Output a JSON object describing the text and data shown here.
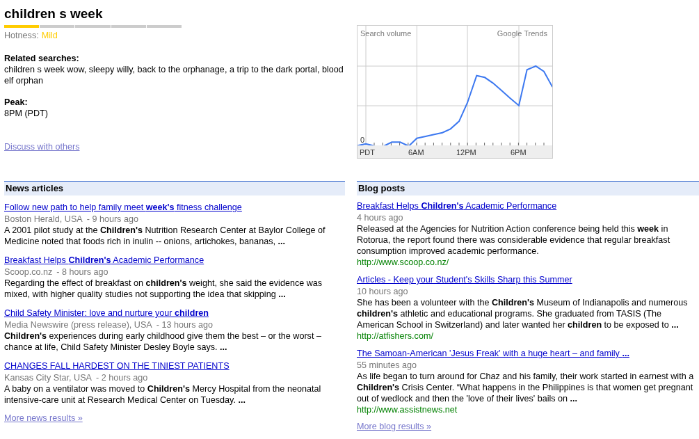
{
  "topic": {
    "title": "children s week",
    "hotness": {
      "label": "Hotness:",
      "value": "Mild",
      "level": 0.2
    },
    "related": {
      "heading": "Related searches:",
      "text": "children s week wow, sleepy willy, back to the orphanage, a trip to the dark portal, blood elf orphan"
    },
    "peak": {
      "heading": "Peak:",
      "value": "8PM (PDT)"
    },
    "discuss_link": "Discuss with others"
  },
  "trend_chart": {
    "title": "Search volume",
    "source": "Google Trends",
    "y_label": "0",
    "x_labels": [
      "PDT",
      "6AM",
      "12PM",
      "6PM"
    ]
  },
  "news": {
    "heading": "News articles",
    "items": [
      {
        "title": "Follow new path to help family meet **week's** fitness challenge",
        "source": "Boston Herald, USA",
        "age": "- 9 hours ago",
        "snippet": "A 2001 pilot study at the **Children's** Nutrition Research Center at Baylor College of Medicine noted that foods rich in inulin -- onions, artichokes, bananas, **...**"
      },
      {
        "title": "Breakfast Helps **Children's** Academic Performance",
        "source": "Scoop.co.nz",
        "age": "- 8 hours ago",
        "snippet": "Regarding the effect of breakfast on **children's** weight, she said the evidence was mixed, with higher quality studies not supporting the idea that skipping **...**"
      },
      {
        "title": "Child Safety Minister: love and nurture your **children**",
        "source": "Media Newswire (press release), USA",
        "age": "- 13 hours ago",
        "snippet": "**Children's** experiences during early childhood give them the best – or the worst – chance at life, Child Safety Minister Desley Boyle says. **...**"
      },
      {
        "title": "CHANGES FALL HARDEST ON THE TINIEST PATIENTS",
        "source": "Kansas City Star, USA",
        "age": "- 2 hours ago",
        "snippet": "A baby on a ventilator was moved to **Children's** Mercy Hospital from the neonatal intensive-care unit at Research Medical Center on Tuesday. **...**"
      }
    ],
    "more": "More news results »"
  },
  "blogs": {
    "heading": "Blog posts",
    "items": [
      {
        "title": "Breakfast Helps **Children's** Academic Performance",
        "age": "4 hours ago",
        "snippet": "Released at the Agencies for Nutrition Action conference being held this **week** in Rotorua, the report found there was considerable evidence that regular breakfast consumption improved academic performance.",
        "url": "http://www.scoop.co.nz/"
      },
      {
        "title": "Articles - Keep your Student's Skills Sharp this Summer",
        "age": "10 hours ago",
        "snippet": "She has been a volunteer with the **Children's** Museum of Indianapolis and numerous **children's** athletic and educational programs. She graduated from TASIS (The American School in Switzerland) and later wanted her **children** to be exposed to **...**",
        "url": "http://atfishers.com/"
      },
      {
        "title": "The Samoan-American 'Jesus Freak' with a huge heart – and family **...**",
        "age": "55 minutes ago",
        "snippet": "As life began to turn around for Chaz and his family, their work started in earnest with a **Children's** Crisis Center. “What happens in the Philippines is that women get pregnant out of wedlock and then the 'love of their lives' bails on **...**",
        "url": "http://www.assistnews.net"
      }
    ],
    "more": "More blog results »"
  }
}
